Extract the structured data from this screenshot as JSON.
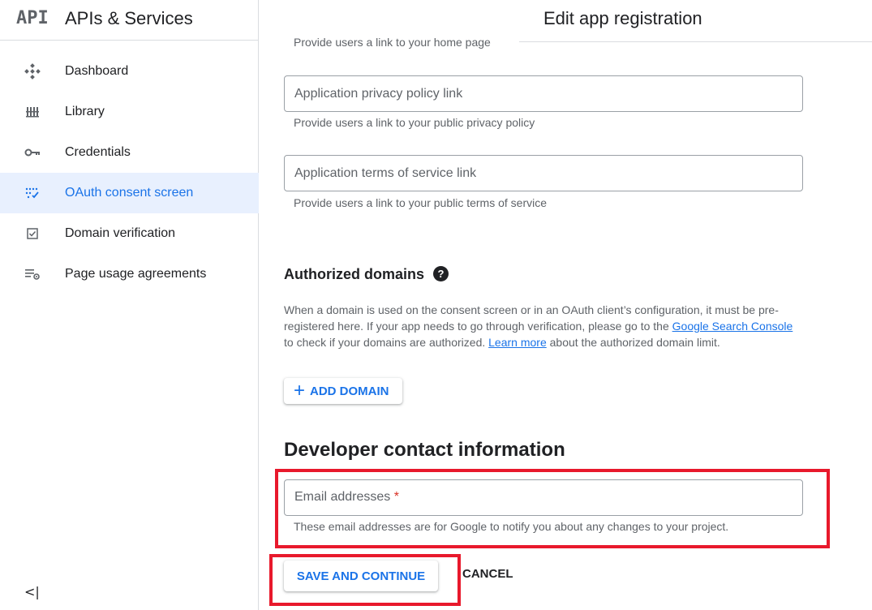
{
  "brand": {
    "logo": "API",
    "title": "APIs & Services"
  },
  "sidebar": {
    "items": [
      {
        "label": "Dashboard",
        "icon": "dashboard-icon"
      },
      {
        "label": "Library",
        "icon": "library-icon"
      },
      {
        "label": "Credentials",
        "icon": "key-icon"
      },
      {
        "label": "OAuth consent screen",
        "icon": "consent-icon",
        "active": true
      },
      {
        "label": "Domain verification",
        "icon": "checkbox-icon"
      },
      {
        "label": "Page usage agreements",
        "icon": "settings-list-icon"
      }
    ],
    "collapse_label": "<|"
  },
  "header": {
    "title": "Edit app registration"
  },
  "form": {
    "home_help": "Provide users a link to your home page",
    "privacy_placeholder": "Application privacy policy link",
    "privacy_help": "Provide users a link to your public privacy policy",
    "terms_placeholder": "Application terms of service link",
    "terms_help": "Provide users a link to your public terms of service",
    "domains_title": "Authorized domains",
    "domains_help_icon": "?",
    "domains_para_1": "When a domain is used on the consent screen or in an OAuth client’s configuration, it must be pre-registered here. If your app needs to go through verification, please go to the ",
    "domains_link_1": "Google Search Console",
    "domains_para_2": " to check if your domains are authorized. ",
    "domains_link_2": "Learn more",
    "domains_para_3": " about the authorized domain limit.",
    "add_domain_label": "ADD DOMAIN",
    "developer_title": "Developer contact information",
    "email_label": "Email addresses",
    "email_required": "*",
    "email_help": "These email addresses are for Google to notify you about any changes to your project.",
    "save_label": "SAVE AND CONTINUE",
    "cancel_label": "CANCEL"
  },
  "colors": {
    "accent": "#1a73e8",
    "highlight": "#e8192c",
    "active_bg": "#e8f0fe"
  }
}
